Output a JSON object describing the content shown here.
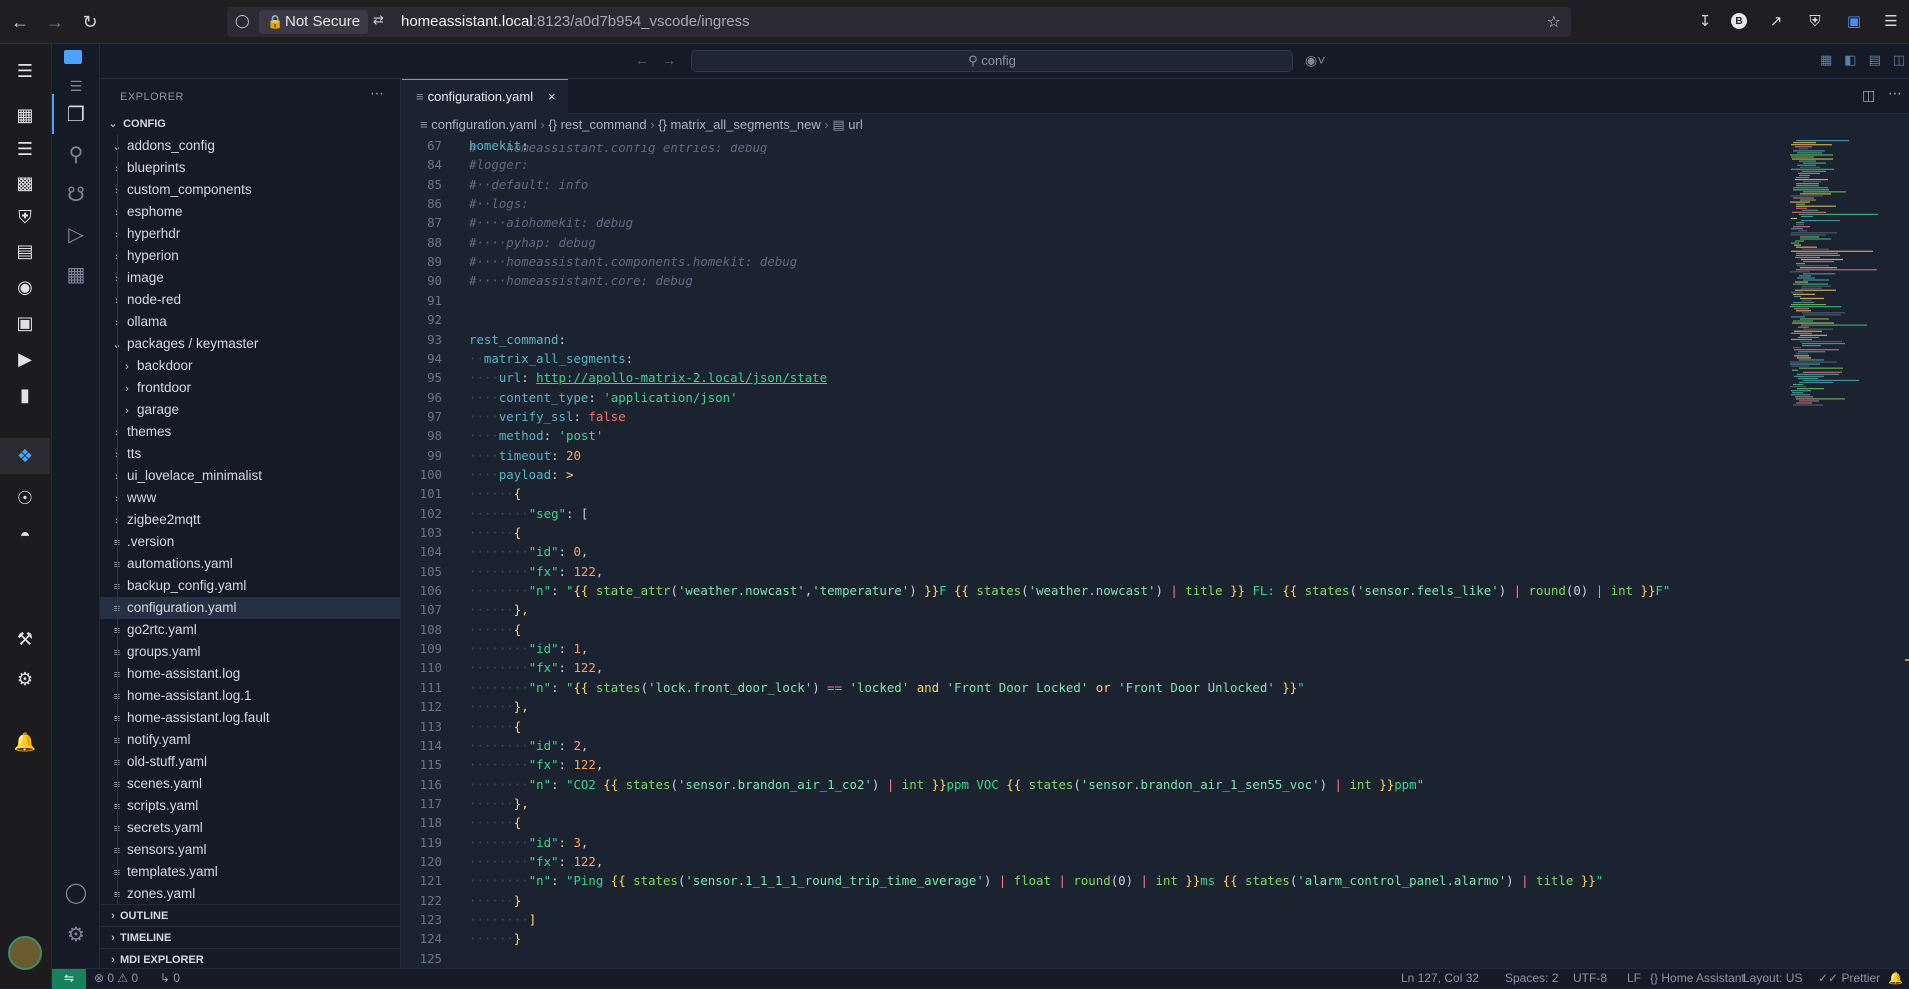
{
  "browser": {
    "not_secure": "Not Secure",
    "url_host": "homeassistant.local",
    "url_path": ":8123/a0d7b954_vscode/ingress"
  },
  "command_center": {
    "placeholder": "config"
  },
  "explorer": {
    "title": "EXPLORER",
    "root": "CONFIG",
    "items": [
      {
        "label": "addons_config",
        "type": "folder",
        "depth": 1,
        "expanded": true
      },
      {
        "label": "blueprints",
        "type": "folder",
        "depth": 1
      },
      {
        "label": "custom_components",
        "type": "folder",
        "depth": 1
      },
      {
        "label": "esphome",
        "type": "folder",
        "depth": 1
      },
      {
        "label": "hyperhdr",
        "type": "folder",
        "depth": 1
      },
      {
        "label": "hyperion",
        "type": "folder",
        "depth": 1
      },
      {
        "label": "image",
        "type": "folder",
        "depth": 1
      },
      {
        "label": "node-red",
        "type": "folder",
        "depth": 1
      },
      {
        "label": "ollama",
        "type": "folder",
        "depth": 1
      },
      {
        "label": "packages / keymaster",
        "type": "folder",
        "depth": 1,
        "expanded": true
      },
      {
        "label": "backdoor",
        "type": "folder",
        "depth": 2
      },
      {
        "label": "frontdoor",
        "type": "folder",
        "depth": 2
      },
      {
        "label": "garage",
        "type": "folder",
        "depth": 2
      },
      {
        "label": "themes",
        "type": "folder",
        "depth": 1
      },
      {
        "label": "tts",
        "type": "folder",
        "depth": 1
      },
      {
        "label": "ui_lovelace_minimalist",
        "type": "folder",
        "depth": 1
      },
      {
        "label": "www",
        "type": "folder",
        "depth": 1
      },
      {
        "label": "zigbee2mqtt",
        "type": "folder",
        "depth": 1
      },
      {
        "label": ".version",
        "type": "file",
        "depth": 1
      },
      {
        "label": "automations.yaml",
        "type": "file",
        "depth": 1
      },
      {
        "label": "backup_config.yaml",
        "type": "file",
        "depth": 1
      },
      {
        "label": "configuration.yaml",
        "type": "file",
        "depth": 1,
        "selected": true
      },
      {
        "label": "go2rtc.yaml",
        "type": "file",
        "depth": 1
      },
      {
        "label": "groups.yaml",
        "type": "file",
        "depth": 1
      },
      {
        "label": "home-assistant.log",
        "type": "file",
        "depth": 1
      },
      {
        "label": "home-assistant.log.1",
        "type": "file",
        "depth": 1
      },
      {
        "label": "home-assistant.log.fault",
        "type": "file",
        "depth": 1
      },
      {
        "label": "notify.yaml",
        "type": "file",
        "depth": 1
      },
      {
        "label": "old-stuff.yaml",
        "type": "file",
        "depth": 1
      },
      {
        "label": "scenes.yaml",
        "type": "file",
        "depth": 1
      },
      {
        "label": "scripts.yaml",
        "type": "file",
        "depth": 1
      },
      {
        "label": "secrets.yaml",
        "type": "file",
        "depth": 1
      },
      {
        "label": "sensors.yaml",
        "type": "file",
        "depth": 1
      },
      {
        "label": "templates.yaml",
        "type": "file",
        "depth": 1
      },
      {
        "label": "zones.yaml",
        "type": "file",
        "depth": 1
      }
    ],
    "sections": [
      "OUTLINE",
      "TIMELINE",
      "MDI EXPLORER"
    ]
  },
  "editor": {
    "tab": "configuration.yaml",
    "breadcrumb": [
      "configuration.yaml",
      "{} rest_command",
      "{} matrix_all_segments_new",
      "url"
    ],
    "lines": [
      {
        "n": "67",
        "t": "homekit:"
      },
      {
        "n": "84",
        "t": "#logger:"
      },
      {
        "n": "85",
        "t": "#  default: info"
      },
      {
        "n": "86",
        "t": "#  logs:"
      },
      {
        "n": "87",
        "t": "#    aiohomekit: debug"
      },
      {
        "n": "88",
        "t": "#    pyhap: debug"
      },
      {
        "n": "89",
        "t": "#    homeassistant.components.homekit: debug"
      },
      {
        "n": "90",
        "t": "#    homeassistant.core: debug"
      },
      {
        "n": "91",
        "t": ""
      },
      {
        "n": "92",
        "t": ""
      },
      {
        "n": "93",
        "t": "rest_command:"
      },
      {
        "n": "94",
        "t": "  matrix_all_segments:"
      },
      {
        "n": "95",
        "t": "    url: http://apollo-matrix-2.local/json/state"
      },
      {
        "n": "96",
        "t": "    content_type: 'application/json'"
      },
      {
        "n": "97",
        "t": "    verify_ssl: false"
      },
      {
        "n": "98",
        "t": "    method: 'post'"
      },
      {
        "n": "99",
        "t": "    timeout: 20"
      },
      {
        "n": "100",
        "t": "    payload: >"
      },
      {
        "n": "101",
        "t": "      {"
      },
      {
        "n": "102",
        "t": "        \"seg\":["
      },
      {
        "n": "103",
        "t": "      {"
      },
      {
        "n": "104",
        "t": "        \"id\": 0,"
      },
      {
        "n": "105",
        "t": "        \"fx\": 122,"
      },
      {
        "n": "106",
        "t": "        \"n\": \"{{ state_attr('weather.nowcast','temperature') }}F {{ states('weather.nowcast') | title }} FL: {{ states('sensor.feels_like') | round(0) | int }}F\""
      },
      {
        "n": "107",
        "t": "      },"
      },
      {
        "n": "108",
        "t": "      {"
      },
      {
        "n": "109",
        "t": "        \"id\": 1,"
      },
      {
        "n": "110",
        "t": "        \"fx\": 122,"
      },
      {
        "n": "111",
        "t": "        \"n\": \"{{ states('lock.front_door_lock') == 'locked' and 'Front Door Locked' or 'Front Door Unlocked' }}\""
      },
      {
        "n": "112",
        "t": "      },"
      },
      {
        "n": "113",
        "t": "      {"
      },
      {
        "n": "114",
        "t": "        \"id\": 2,"
      },
      {
        "n": "115",
        "t": "        \"fx\": 122,"
      },
      {
        "n": "116",
        "t": "        \"n\": \"CO2 {{ states('sensor.brandon_air_1_co2') | int }}ppm VOC {{ states('sensor.brandon_air_1_sen55_voc') | int }}ppm\""
      },
      {
        "n": "117",
        "t": "      },"
      },
      {
        "n": "118",
        "t": "      {"
      },
      {
        "n": "119",
        "t": "        \"id\": 3,"
      },
      {
        "n": "120",
        "t": "        \"fx\": 122,"
      },
      {
        "n": "121",
        "t": "        \"n\": \"Ping {{ states('sensor.1_1_1_1_round_trip_time_average') | float | round(0) | int }}ms {{ states('alarm_control_panel.alarmo') | title }}\""
      },
      {
        "n": "122",
        "t": "      }"
      },
      {
        "n": "123",
        "t": "        ]"
      },
      {
        "n": "124",
        "t": "      }"
      },
      {
        "n": "125",
        "t": ""
      }
    ],
    "overflow_comment": "#    homeassistant.config_entries: debug"
  },
  "status_bar": {
    "problems": "0",
    "warnings": "0",
    "ports": "0",
    "position": "Ln 127, Col 32",
    "spaces": "Spaces: 2",
    "encoding": "UTF-8",
    "eol": "LF",
    "schema": "Home Assistant",
    "layout": "Layout: US",
    "formatter": "Prettier"
  },
  "colors": {
    "accent": "#4ba3ff",
    "remote": "#16825d",
    "editor_bg": "#1b2230"
  }
}
